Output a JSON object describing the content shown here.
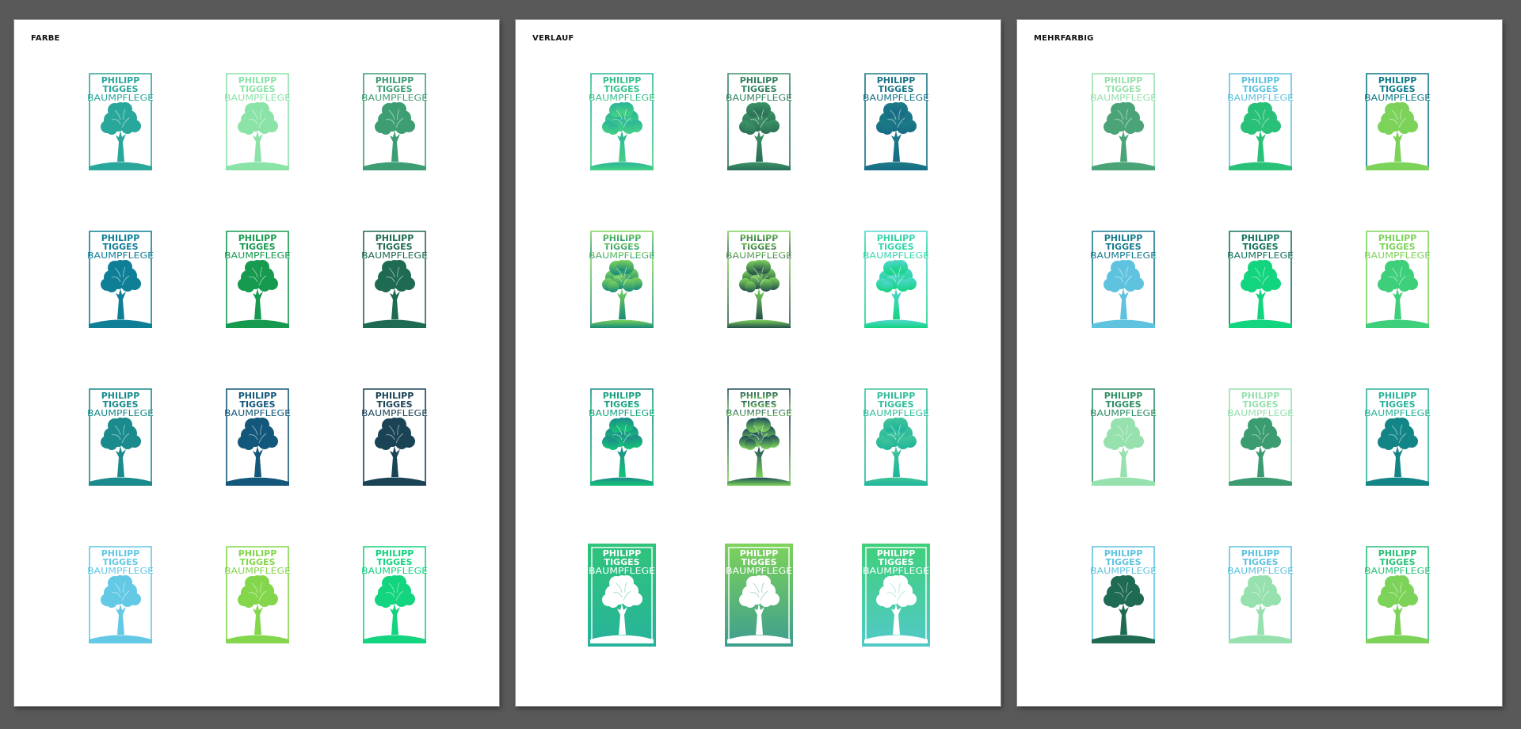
{
  "logo_text": {
    "line1": "PHILIPP",
    "line2": "TIGGES",
    "line3": "BAUMPFLEGE"
  },
  "artboards": [
    {
      "label": "FARBE",
      "logos": [
        {
          "kind": "solid",
          "c": "#2aa79b",
          "c2": "#2aa79b"
        },
        {
          "kind": "solid",
          "c": "#8be3a8",
          "c2": "#8be3a8"
        },
        {
          "kind": "solid",
          "c": "#3e9e73",
          "c2": "#3e9e73"
        },
        {
          "kind": "solid",
          "c": "#0f7f98",
          "c2": "#0f7f98"
        },
        {
          "kind": "solid",
          "c": "#169a4f",
          "c2": "#169a4f"
        },
        {
          "kind": "solid",
          "c": "#1e6a52",
          "c2": "#1e6a52"
        },
        {
          "kind": "solid",
          "c": "#1a8a8c",
          "c2": "#1a8a8c"
        },
        {
          "kind": "solid",
          "c": "#13577a",
          "c2": "#13577a"
        },
        {
          "kind": "solid",
          "c": "#1b4356",
          "c2": "#1b4356"
        },
        {
          "kind": "solid",
          "c": "#63c9e4",
          "c2": "#63c9e4"
        },
        {
          "kind": "solid",
          "c": "#84d64c",
          "c2": "#84d64c"
        },
        {
          "kind": "solid",
          "c": "#13d47f",
          "c2": "#13d47f"
        }
      ]
    },
    {
      "label": "VERLAUF",
      "logos": [
        {
          "kind": "gradient",
          "c": "#2ab39b",
          "c2": "#46d282"
        },
        {
          "kind": "gradient",
          "c": "#3c9466",
          "c2": "#2a6e56"
        },
        {
          "kind": "gradient",
          "c": "#1c7c86",
          "c2": "#176b86"
        },
        {
          "kind": "gradient",
          "c": "#7dd35a",
          "c2": "#178a79"
        },
        {
          "kind": "gradient",
          "c": "#7dd35a",
          "c2": "#24504a"
        },
        {
          "kind": "gradient",
          "c": "#52d6d0",
          "c2": "#13d47f"
        },
        {
          "kind": "gradient",
          "c": "#1d8a8a",
          "c2": "#16c478"
        },
        {
          "kind": "gradient",
          "c": "#1e4b5a",
          "c2": "#7dd35a"
        },
        {
          "kind": "gradient",
          "c": "#42c49a",
          "c2": "#1eb59b"
        },
        {
          "kind": "filled",
          "c": "#2fc47a",
          "c2": "#27b39b"
        },
        {
          "kind": "filled",
          "c": "#7dd35a",
          "c2": "#3e9e8e"
        },
        {
          "kind": "filled",
          "c": "#3fd07a",
          "c2": "#52c9c8"
        }
      ]
    },
    {
      "label": "MEHRFARBIG",
      "logos": [
        {
          "kind": "multi",
          "c": "#97e1ae",
          "c2": "#4ba477"
        },
        {
          "kind": "multi",
          "c": "#5fc3df",
          "c2": "#29c178"
        },
        {
          "kind": "multi",
          "c": "#0f7a8a",
          "c2": "#7dd35a"
        },
        {
          "kind": "multi",
          "c": "#177b8f",
          "c2": "#5fc3df"
        },
        {
          "kind": "multi",
          "c": "#17735f",
          "c2": "#13d47f"
        },
        {
          "kind": "multi",
          "c": "#7dd35a",
          "c2": "#3ecf7a"
        },
        {
          "kind": "multi",
          "c": "#2f8e63",
          "c2": "#97e1ae"
        },
        {
          "kind": "multi",
          "c": "#97e1ae",
          "c2": "#3a9c70"
        },
        {
          "kind": "multi",
          "c": "#2ab39b",
          "c2": "#148586"
        },
        {
          "kind": "multi",
          "c": "#5fc3df",
          "c2": "#1e6a52"
        },
        {
          "kind": "multi",
          "c": "#5fc3df",
          "c2": "#97e1ae"
        },
        {
          "kind": "multi",
          "c": "#29c178",
          "c2": "#7dd35a"
        }
      ]
    }
  ]
}
